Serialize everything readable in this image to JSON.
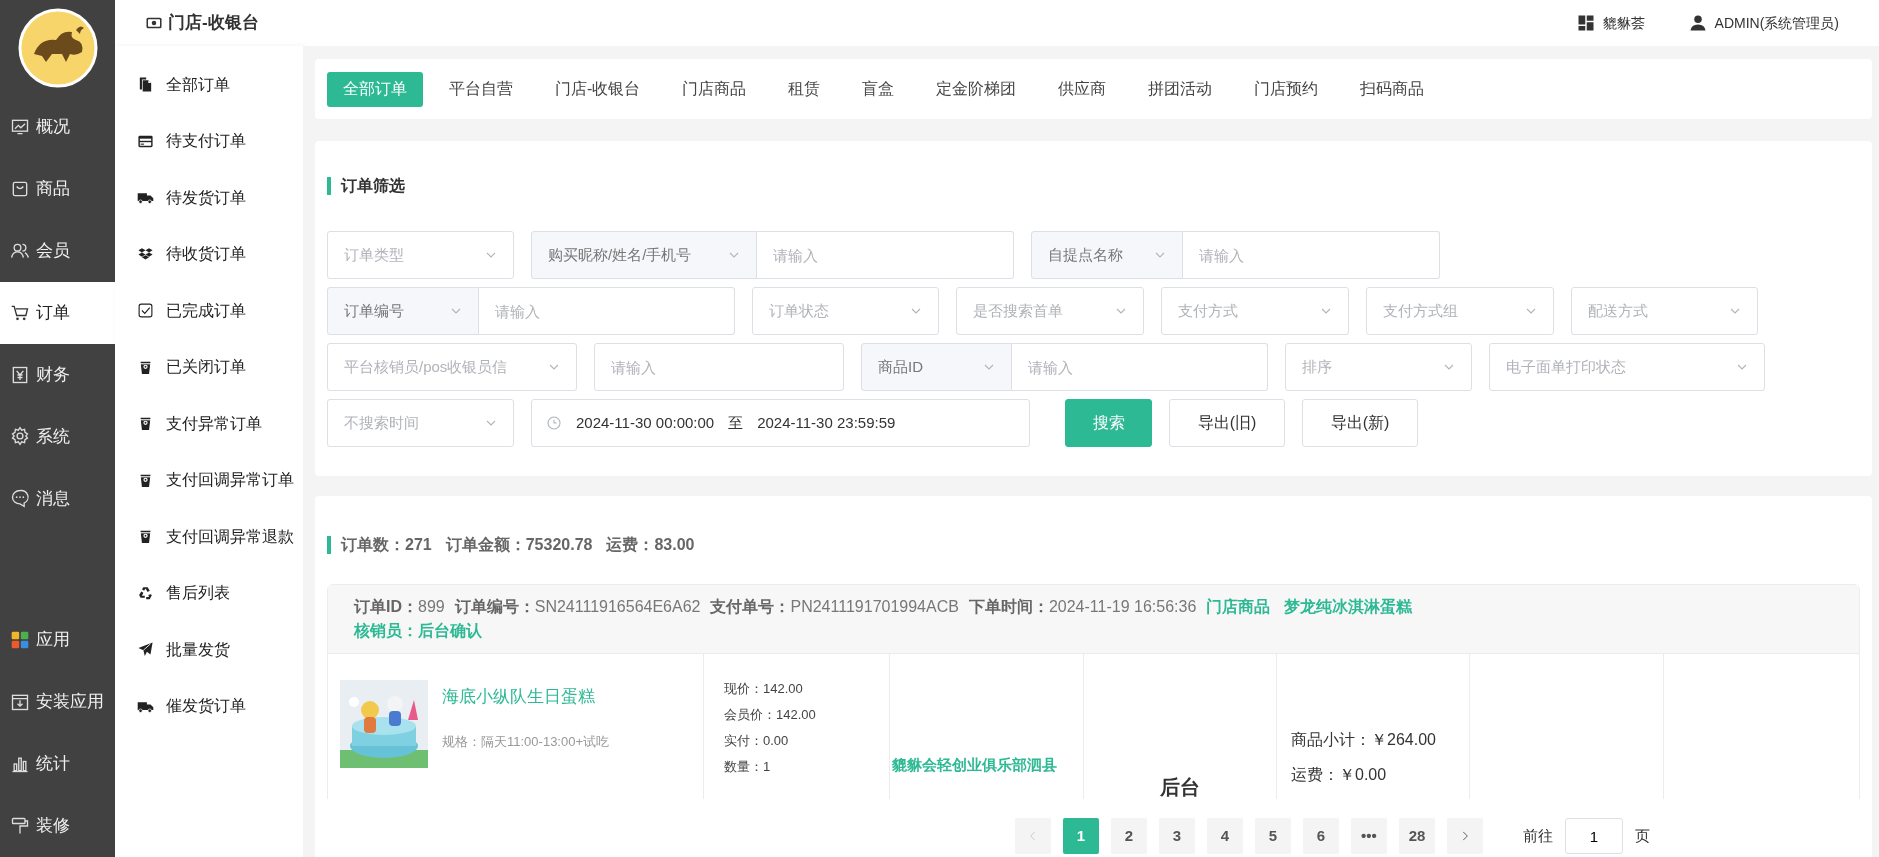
{
  "header": {
    "title": "门店-收银台",
    "shop": "貔貅荟",
    "user": "ADMIN(系统管理员)"
  },
  "main_nav": [
    {
      "label": "概况",
      "selected": false
    },
    {
      "label": "商品",
      "selected": false
    },
    {
      "label": "会员",
      "selected": false
    },
    {
      "label": "订单",
      "selected": true
    },
    {
      "label": "财务",
      "selected": false
    },
    {
      "label": "系统",
      "selected": false
    },
    {
      "label": "消息",
      "selected": false
    }
  ],
  "app_nav": [
    {
      "label": "应用",
      "selected": false
    },
    {
      "label": "安装应用",
      "selected": false
    },
    {
      "label": "统计",
      "selected": false
    },
    {
      "label": "装修",
      "selected": false
    }
  ],
  "sub_nav": [
    {
      "label": "全部订单"
    },
    {
      "label": "待支付订单"
    },
    {
      "label": "待发货订单"
    },
    {
      "label": "待收货订单"
    },
    {
      "label": "已完成订单"
    },
    {
      "label": "已关闭订单"
    },
    {
      "label": "支付异常订单"
    },
    {
      "label": "支付回调异常订单"
    },
    {
      "label": "支付回调异常退款"
    },
    {
      "label": "售后列表"
    },
    {
      "label": "批量发货"
    },
    {
      "label": "催发货订单"
    }
  ],
  "tabs": [
    {
      "label": "全部订单",
      "selected": true
    },
    {
      "label": "平台自营",
      "selected": false
    },
    {
      "label": "门店-收银台",
      "selected": false
    },
    {
      "label": "门店商品",
      "selected": false
    },
    {
      "label": "租赁",
      "selected": false
    },
    {
      "label": "盲盒",
      "selected": false
    },
    {
      "label": "定金阶梯团",
      "selected": false
    },
    {
      "label": "供应商",
      "selected": false
    },
    {
      "label": "拼团活动",
      "selected": false
    },
    {
      "label": "门店预约",
      "selected": false
    },
    {
      "label": "扫码商品",
      "selected": false
    }
  ],
  "filter": {
    "title": "订单筛选",
    "fields": [
      {
        "kind": "select",
        "placeholder": "订单类型"
      },
      {
        "kind": "group",
        "prefix": "购买昵称/姓名/手机号",
        "placeholder": "请输入"
      },
      {
        "kind": "group",
        "prefix": "自提点名称",
        "placeholder": "请输入"
      },
      {
        "kind": "group",
        "prefix": "订单编号",
        "placeholder": "请输入"
      },
      {
        "kind": "select",
        "placeholder": "订单状态"
      },
      {
        "kind": "select",
        "placeholder": "是否搜索首单"
      },
      {
        "kind": "select",
        "placeholder": "支付方式"
      },
      {
        "kind": "select",
        "placeholder": "支付方式组"
      },
      {
        "kind": "select",
        "placeholder": "配送方式"
      },
      {
        "kind": "select",
        "placeholder": "平台核销员/pos收银员信"
      },
      {
        "kind": "input",
        "placeholder": "请输入"
      },
      {
        "kind": "group",
        "prefix": "商品ID",
        "placeholder": "请输入"
      },
      {
        "kind": "select",
        "placeholder": "排序"
      },
      {
        "kind": "select",
        "placeholder": "电子面单打印状态"
      },
      {
        "kind": "select",
        "placeholder": "不搜索时间"
      },
      {
        "kind": "daterange",
        "start": "2024-11-30 00:00:00",
        "separator": "至",
        "end": "2024-11-30 23:59:59"
      },
      {
        "kind": "primary",
        "label": "搜索"
      },
      {
        "kind": "button",
        "label": "导出(旧)"
      },
      {
        "kind": "button",
        "label": "导出(新)"
      }
    ]
  },
  "stats": [
    "订单数：271",
    "订单金额：75320.78",
    "运费：83.00"
  ],
  "order": {
    "fields": [
      "**订单ID：**899",
      "**订单编号：**SN24111916564E6A62",
      "**支付单号：**PN2411191701994ACB",
      "**下单时间：**2024-11-19 16:56:36"
    ],
    "tags": [
      "门店商品",
      "梦龙纯冰淇淋蛋糕"
    ],
    "verifier": "核销员：后台确认",
    "product": {
      "name": "海底小纵队生日蛋糕",
      "spec": "规格：隔天11:00-13:00+试吃"
    },
    "prices": [
      "现价：142.00",
      "会员价：142.00",
      "实付：0.00",
      "数量：1"
    ],
    "store": "貔貅会轻创业俱乐部泗县",
    "column_4": "后台",
    "totals": [
      "商品小计：￥264.00",
      "运费：￥0.00"
    ]
  },
  "pagination": {
    "prev": {
      "disabled": true
    },
    "pages": [
      {
        "label": "1",
        "selected": true
      },
      {
        "label": "2",
        "selected": false
      },
      {
        "label": "3",
        "selected": false
      },
      {
        "label": "4",
        "selected": false
      },
      {
        "label": "5",
        "selected": false
      },
      {
        "label": "6",
        "selected": false
      },
      {
        "label": "•••",
        "selected": false
      },
      {
        "label": "28",
        "selected": false
      }
    ],
    "next": {
      "disabled": false
    },
    "goto_label": "前往",
    "goto_value": "1",
    "page_unit": "页"
  }
}
